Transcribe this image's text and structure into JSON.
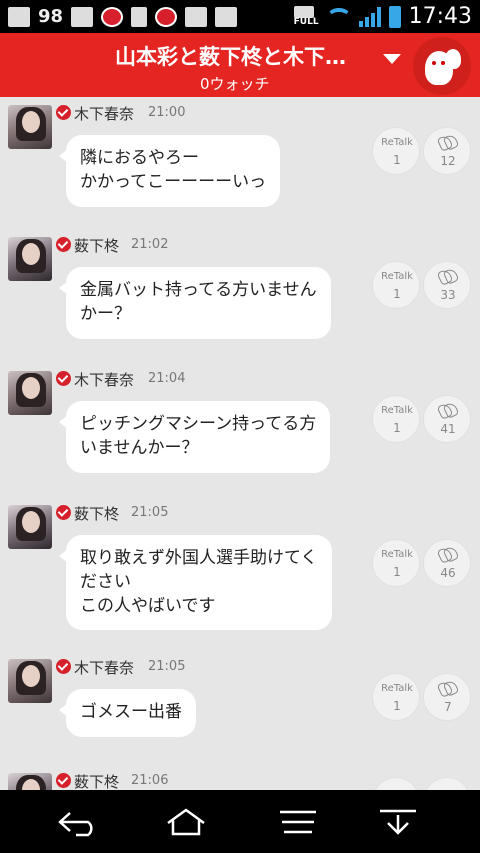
{
  "status_bar": {
    "notification_count": "98",
    "clock": "17:43",
    "full_label": "FULL",
    "icons": [
      "gmail-icon",
      "98-counter",
      "e-icon",
      "search-app-icon",
      "phone-icon",
      "trend-micro-icon",
      "briefcase-icon",
      "clipboard-icon",
      "full-icon",
      "wifi-icon",
      "signal-icon",
      "battery-icon"
    ],
    "accent_color": "#37a7e8"
  },
  "header": {
    "title": "山本彩と薮下柊と木下…",
    "subtitle": "0ウォッチ",
    "bg_color": "#e42521"
  },
  "messages": [
    {
      "sender": "木下春奈",
      "time": "21:00",
      "text": "隣におるやろー\nかかってこーーーーいっ",
      "retalk_label": "ReTalk",
      "retalk_count": "1",
      "clap_count": "12"
    },
    {
      "sender": "薮下柊",
      "time": "21:02",
      "text": "金属バット持ってる方いません\nかー？",
      "retalk_label": "ReTalk",
      "retalk_count": "1",
      "clap_count": "33"
    },
    {
      "sender": "木下春奈",
      "time": "21:04",
      "text": "ピッチングマシーン持ってる方\nいませんかー？",
      "retalk_label": "ReTalk",
      "retalk_count": "1",
      "clap_count": "41"
    },
    {
      "sender": "薮下柊",
      "time": "21:05",
      "text": "取り敢えず外国人選手助けてく\nださい\nこの人やばいです",
      "retalk_label": "ReTalk",
      "retalk_count": "1",
      "clap_count": "46"
    },
    {
      "sender": "木下春奈",
      "time": "21:05",
      "text": "ゴメスー出番",
      "retalk_label": "ReTalk",
      "retalk_count": "1",
      "clap_count": "7"
    },
    {
      "sender": "薮下柊",
      "time": "21:06",
      "text": "",
      "retalk_label": "",
      "retalk_count": "",
      "clap_count": ""
    }
  ],
  "nav": {
    "buttons": [
      "back-icon",
      "home-icon",
      "menu-icon",
      "download-icon"
    ]
  }
}
